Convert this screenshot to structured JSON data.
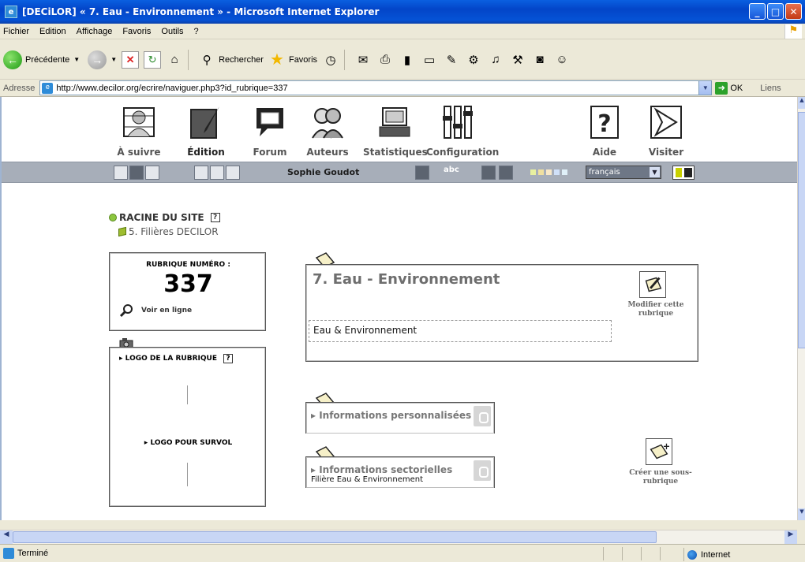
{
  "window": {
    "title": "[DECiLOR] « 7. Eau - Environnement » - Microsoft Internet Explorer",
    "buttons": [
      "minimize",
      "maximize",
      "close"
    ]
  },
  "menu": {
    "items": [
      "Fichier",
      "Edition",
      "Affichage",
      "Favoris",
      "Outils",
      "?"
    ]
  },
  "toolbar": {
    "back_label": "Précédente",
    "search_label": "Rechercher",
    "favorites_label": "Favoris"
  },
  "address": {
    "label": "Adresse",
    "url": "http://www.decilor.org/ecrire/naviguer.php3?id_rubrique=337",
    "ok_label": "OK",
    "links_label": "Liens"
  },
  "nav": {
    "items": [
      {
        "label": "À suivre",
        "icon": "people-icon"
      },
      {
        "label": "Édition",
        "icon": "pen-paper-icon",
        "active": true
      },
      {
        "label": "Forum",
        "icon": "speech-bubble-icon"
      },
      {
        "label": "Auteurs",
        "icon": "authors-icon"
      },
      {
        "label": "Statistiques",
        "icon": "computer-icon"
      },
      {
        "label": "Configuration",
        "icon": "sliders-icon"
      },
      {
        "label": "Aide",
        "icon": "help-icon"
      },
      {
        "label": "Visiter",
        "icon": "visit-arrow-icon"
      }
    ]
  },
  "subbar": {
    "user": "Sophie Goudot",
    "spell": "abc",
    "language": "français"
  },
  "breadcrumb": {
    "root": "RACINE DU SITE",
    "help": "?",
    "section": "5. Filières DECILOR"
  },
  "rubrique": {
    "number_label": "RUBRIQUE NUMÉRO :",
    "number": "337",
    "view_online": "Voir en ligne"
  },
  "logo_panel": {
    "logo_label": "LOGO DE LA RUBRIQUE",
    "hover_label": "LOGO POUR SURVOL",
    "help": "?"
  },
  "main": {
    "title": "7. Eau - Environnement",
    "description": "Eau & Environnement",
    "modify_label": "Modifier cette rubrique"
  },
  "info_personal": {
    "title": "Informations personnalisées"
  },
  "info_sector": {
    "title": "Informations sectorielles",
    "subtitle": "Filière Eau & Environnement"
  },
  "create": {
    "label": "Créer une sous-rubrique"
  },
  "status": {
    "text": "Terminé",
    "zone": "Internet"
  },
  "colors": {
    "titlebar": "#0553D6",
    "subbar": "#A7AEB9",
    "content_bg": "#FFFFFF",
    "chrome": "#ECE9D8"
  }
}
